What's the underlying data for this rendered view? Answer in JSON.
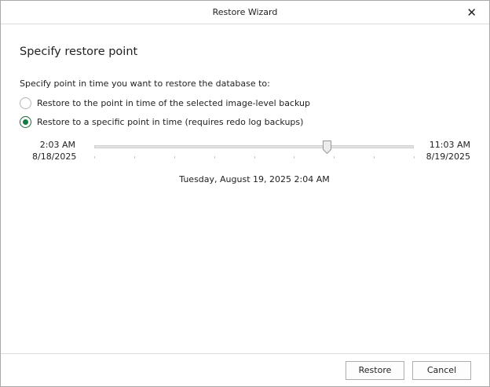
{
  "window": {
    "title": "Restore Wizard"
  },
  "page": {
    "heading": "Specify restore point",
    "prompt": "Specify point in time you want to restore the database to:"
  },
  "options": [
    {
      "label": "Restore to the point in time of the selected image-level backup",
      "selected": false
    },
    {
      "label": "Restore to a specific point in time (requires redo log backups)",
      "selected": true
    }
  ],
  "slider": {
    "start_time": "2:03 AM",
    "start_date": "8/18/2025",
    "end_time": "11:03 AM",
    "end_date": "8/19/2025",
    "position": 0.727,
    "selected_label": "Tuesday, August 19, 2025 2:04 AM"
  },
  "buttons": {
    "restore": "Restore",
    "cancel": "Cancel"
  },
  "colors": {
    "accent": "#107c41"
  }
}
